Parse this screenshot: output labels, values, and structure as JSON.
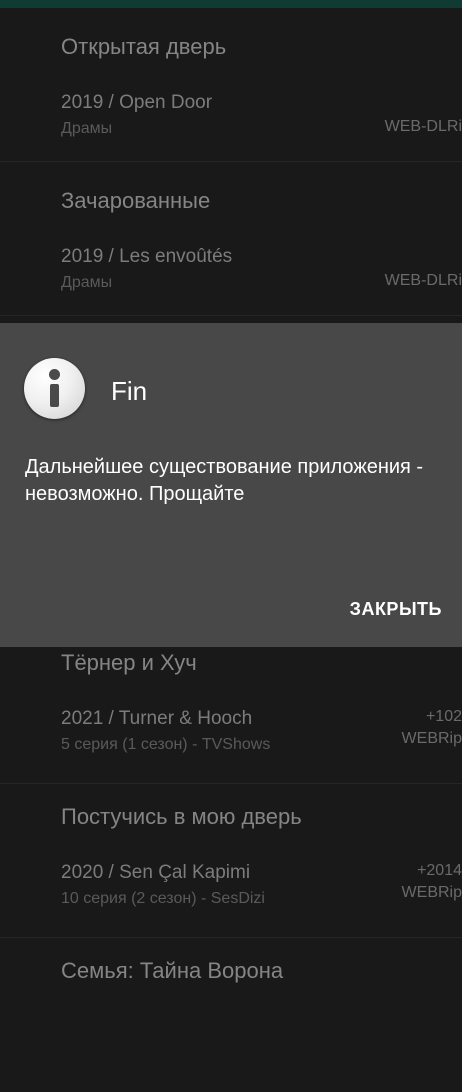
{
  "list": {
    "items": [
      {
        "title": "Открытая дверь",
        "year_title": "2019 / Open Door",
        "subtitle": "Драмы",
        "right_top": "",
        "right_bottom": "WEB-DLRi"
      },
      {
        "title": "Зачарованные",
        "year_title": "2019 / Les envoûtés",
        "subtitle": "Драмы",
        "right_top": "",
        "right_bottom": "WEB-DLRi"
      },
      {
        "title": "Тёрнер и Хуч",
        "year_title": "2021 / Turner & Hooch",
        "subtitle": "5 серия (1 сезон) - TVShows",
        "right_top": "+102",
        "right_bottom": "WEBRip"
      },
      {
        "title": "Постучись в мою дверь",
        "year_title": "2020 / Sen Çal Kapimi",
        "subtitle": "10 серия (2 сезон) - SesDizi",
        "right_top": "+2014",
        "right_bottom": "WEBRip"
      },
      {
        "title": "Семья: Тайна Ворона"
      }
    ]
  },
  "dialog": {
    "icon": "info-icon",
    "title": "Fin",
    "message": "Дальнейшее существование приложения - невозможно. Прощайте",
    "close_label": "ЗАКРЫТЬ"
  },
  "colors": {
    "top_bar": "#0f3b32",
    "background": "#191919",
    "dialog_background": "#484848"
  }
}
